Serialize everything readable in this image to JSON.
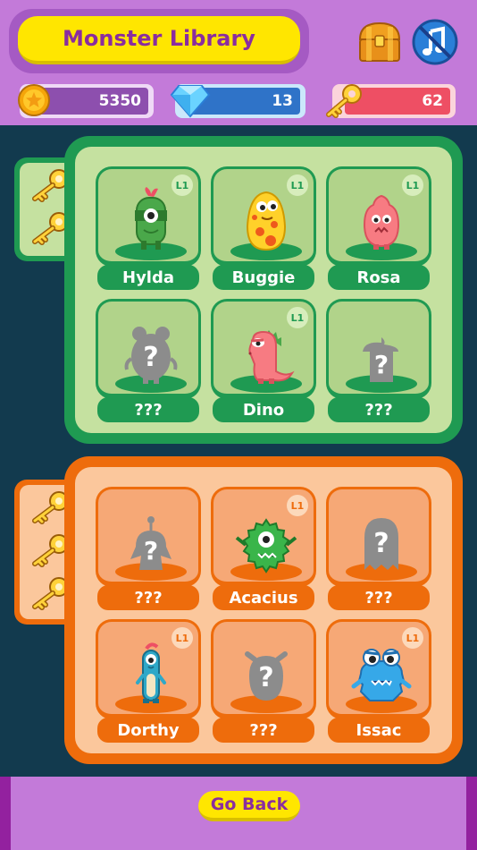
{
  "header": {
    "title": "Monster Library",
    "chest_icon": "treasure-chest-icon",
    "music_icon": "music-muted-icon"
  },
  "stats": {
    "coins": "5350",
    "gems": "13",
    "keys": "62"
  },
  "sections": [
    {
      "theme": "green",
      "keys_required": 2,
      "cards": [
        {
          "label": "Hylda",
          "level": "L1",
          "unlocked": true
        },
        {
          "label": "Buggie",
          "level": "L1",
          "unlocked": true
        },
        {
          "label": "Rosa",
          "level": "L1",
          "unlocked": true
        },
        {
          "label": "???",
          "level": "",
          "unlocked": false
        },
        {
          "label": "Dino",
          "level": "L1",
          "unlocked": true
        },
        {
          "label": "???",
          "level": "",
          "unlocked": false
        }
      ]
    },
    {
      "theme": "orange",
      "keys_required": 3,
      "cards": [
        {
          "label": "???",
          "level": "",
          "unlocked": false
        },
        {
          "label": "Acacius",
          "level": "L1",
          "unlocked": true
        },
        {
          "label": "???",
          "level": "",
          "unlocked": false
        },
        {
          "label": "Dorthy",
          "level": "L1",
          "unlocked": true
        },
        {
          "label": "???",
          "level": "",
          "unlocked": false
        },
        {
          "label": "Issac",
          "level": "L1",
          "unlocked": true
        }
      ]
    }
  ],
  "footer": {
    "go_back_label": "Go Back"
  },
  "colors": {
    "header_bg": "#c37ad9",
    "title_pill": "#ffe600",
    "title_text": "#8a2d9f",
    "green_accent": "#1f9a52",
    "orange_accent": "#ee6c0c",
    "page_bg": "#123a4e"
  }
}
